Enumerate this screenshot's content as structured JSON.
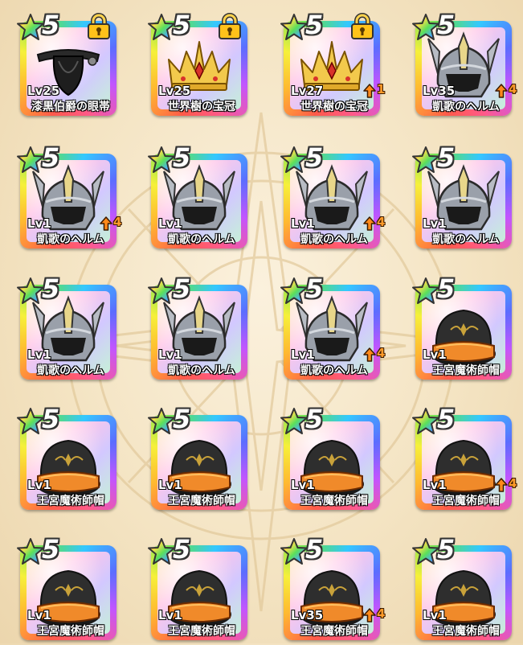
{
  "rarity_text": "5",
  "accent_colors": {
    "upgrade": "#ff9a2a",
    "background": "#f4e4c3"
  },
  "items": [
    {
      "art": "eyepatch-icon",
      "level": "Lv25",
      "name": "漆黒伯爵の眼帯",
      "locked": true,
      "upgrade": ""
    },
    {
      "art": "crown-icon",
      "level": "Lv25",
      "name": "世界樹の宝冠",
      "locked": true,
      "upgrade": ""
    },
    {
      "art": "crown-icon",
      "level": "Lv27",
      "name": "世界樹の宝冠",
      "locked": true,
      "upgrade": "1"
    },
    {
      "art": "helm-icon",
      "level": "Lv35",
      "name": "凱歌のヘルム",
      "locked": false,
      "upgrade": "4"
    },
    {
      "art": "helm-icon",
      "level": "Lv1",
      "name": "凱歌のヘルム",
      "locked": false,
      "upgrade": "4"
    },
    {
      "art": "helm-icon",
      "level": "Lv1",
      "name": "凱歌のヘルム",
      "locked": false,
      "upgrade": ""
    },
    {
      "art": "helm-icon",
      "level": "Lv1",
      "name": "凱歌のヘルム",
      "locked": false,
      "upgrade": "4"
    },
    {
      "art": "helm-icon",
      "level": "Lv1",
      "name": "凱歌のヘルム",
      "locked": false,
      "upgrade": ""
    },
    {
      "art": "helm-icon",
      "level": "Lv1",
      "name": "凱歌のヘルム",
      "locked": false,
      "upgrade": ""
    },
    {
      "art": "helm-icon",
      "level": "Lv1",
      "name": "凱歌のヘルム",
      "locked": false,
      "upgrade": ""
    },
    {
      "art": "helm-icon",
      "level": "Lv1",
      "name": "凱歌のヘルム",
      "locked": false,
      "upgrade": "4"
    },
    {
      "art": "hat-icon",
      "level": "Lv1",
      "name": "王宮魔術師帽",
      "locked": false,
      "upgrade": ""
    },
    {
      "art": "hat-icon",
      "level": "Lv1",
      "name": "王宮魔術師帽",
      "locked": false,
      "upgrade": ""
    },
    {
      "art": "hat-icon",
      "level": "Lv1",
      "name": "王宮魔術師帽",
      "locked": false,
      "upgrade": ""
    },
    {
      "art": "hat-icon",
      "level": "Lv1",
      "name": "王宮魔術師帽",
      "locked": false,
      "upgrade": ""
    },
    {
      "art": "hat-icon",
      "level": "Lv1",
      "name": "王宮魔術師帽",
      "locked": false,
      "upgrade": "4"
    },
    {
      "art": "hat-icon",
      "level": "Lv1",
      "name": "王宮魔術師帽",
      "locked": false,
      "upgrade": ""
    },
    {
      "art": "hat-icon",
      "level": "Lv1",
      "name": "王宮魔術師帽",
      "locked": false,
      "upgrade": ""
    },
    {
      "art": "hat-icon",
      "level": "Lv35",
      "name": "王宮魔術師帽",
      "locked": false,
      "upgrade": "4"
    },
    {
      "art": "hat-icon",
      "level": "Lv1",
      "name": "王宮魔術師帽",
      "locked": false,
      "upgrade": ""
    }
  ]
}
